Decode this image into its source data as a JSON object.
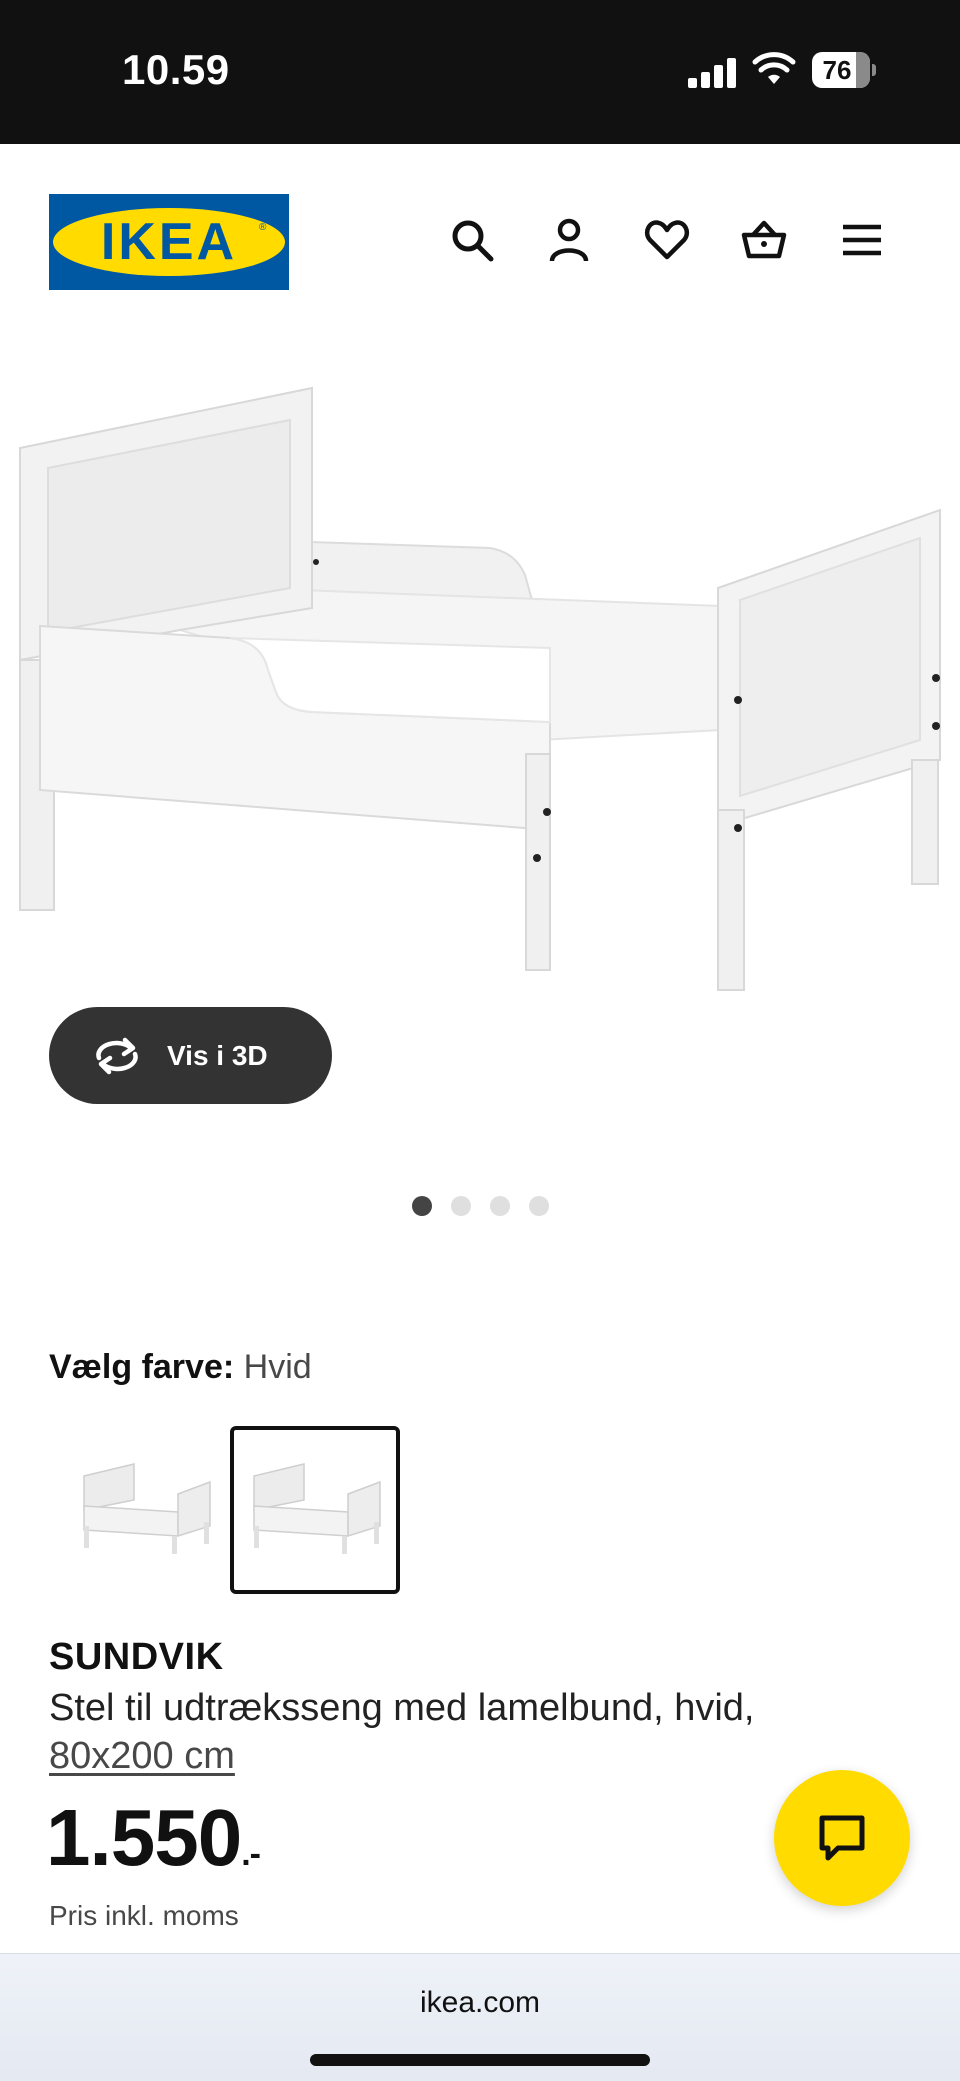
{
  "status_bar": {
    "time": "10.59",
    "battery": "76"
  },
  "header": {
    "logo_text": "IKEA",
    "icons": [
      "search-icon",
      "account-icon",
      "heart-icon",
      "basket-icon",
      "menu-icon"
    ]
  },
  "gallery": {
    "view_3d_label": "Vis i 3D",
    "image_count": 4,
    "active_index": 0
  },
  "color_choice": {
    "label": "Vælg farve:",
    "value": "Hvid",
    "selected_index": 1
  },
  "product": {
    "name": "SUNDVIK",
    "description": "Stel til udtræksseng med lamelbund, hvid,",
    "size": "80x200 cm",
    "price": "1.550",
    "price_suffix": ".-",
    "price_note": "Pris inkl. moms"
  },
  "browser": {
    "url": "ikea.com"
  },
  "colors": {
    "brand_blue": "#0058a3",
    "brand_yellow": "#ffdb00",
    "button_dark": "#333333"
  }
}
